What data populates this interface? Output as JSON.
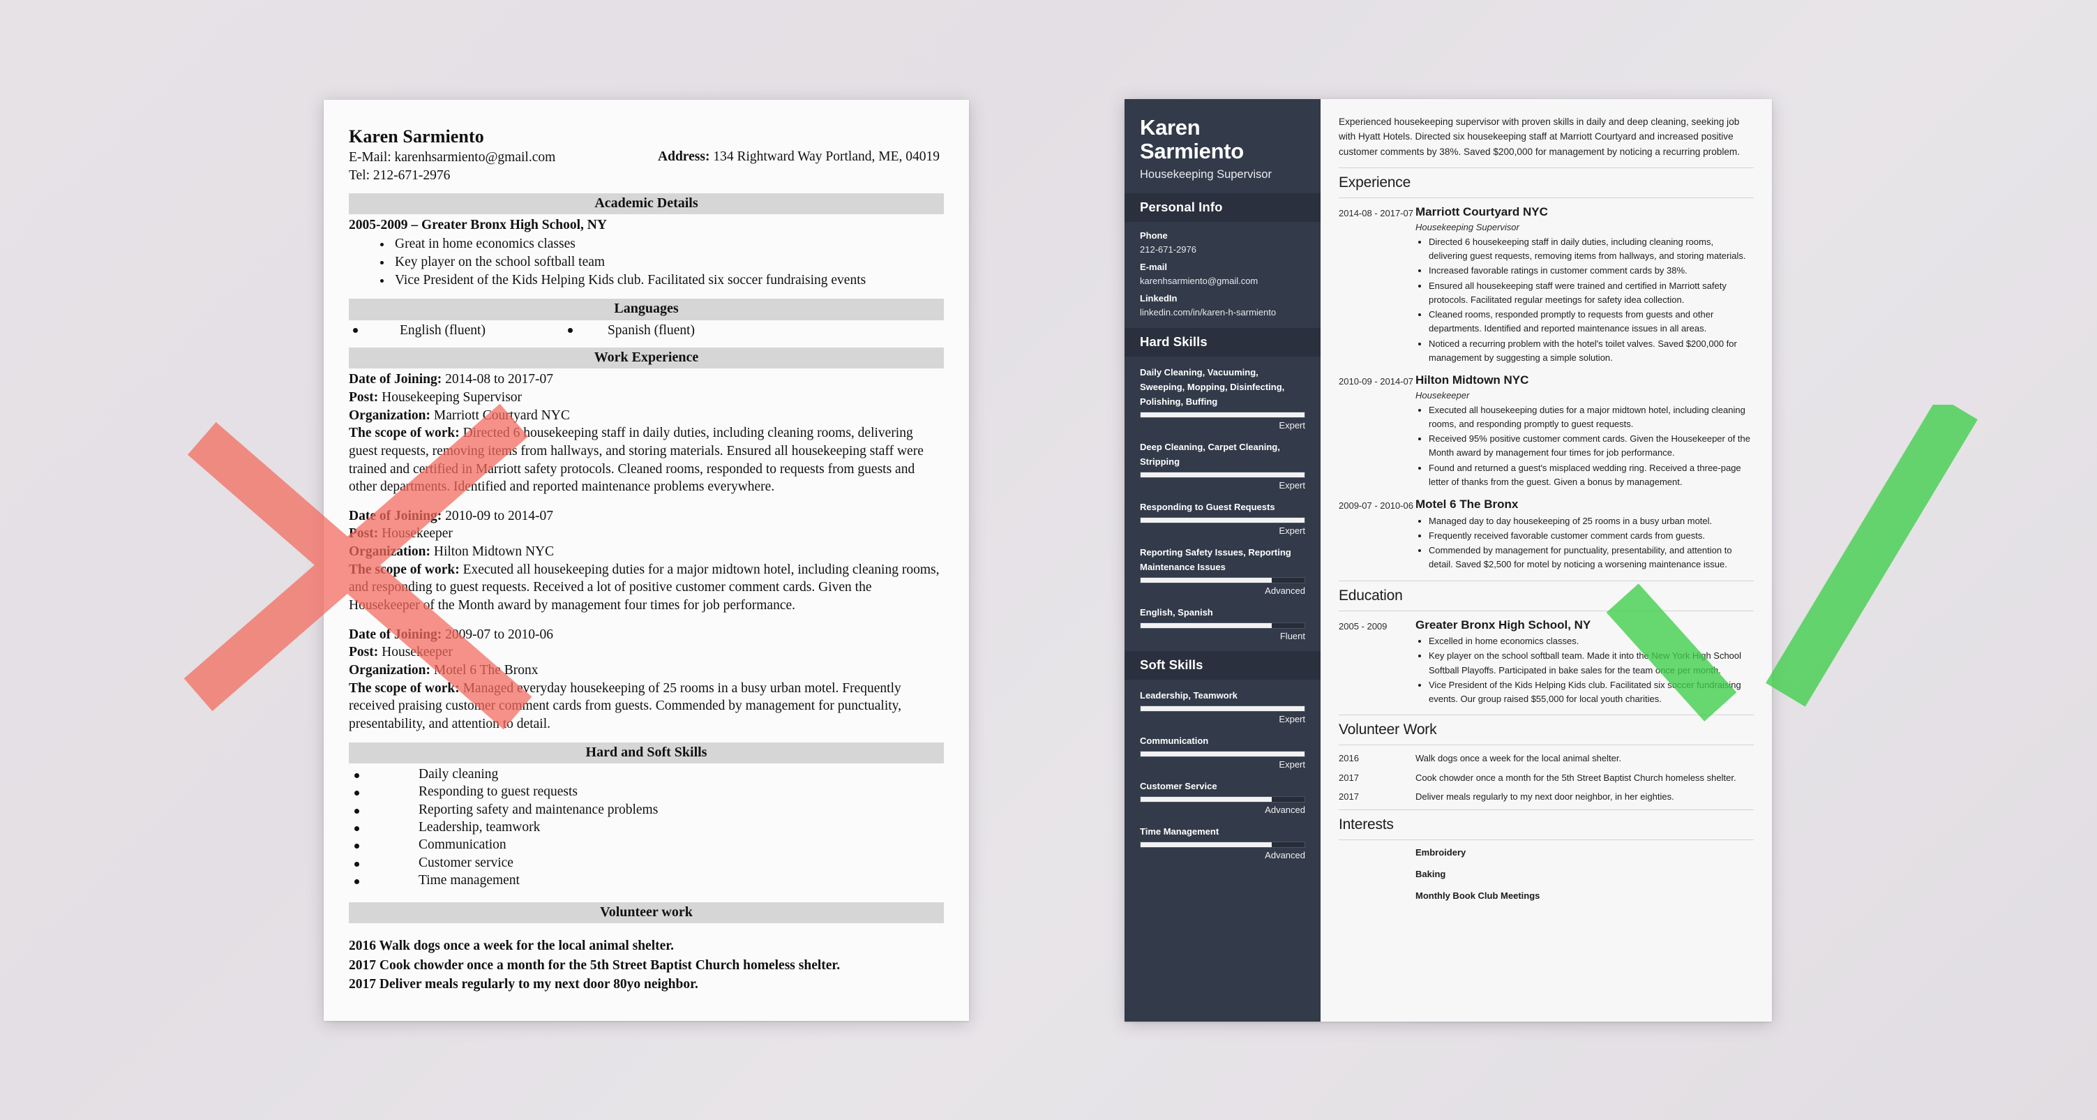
{
  "marks": {
    "bad_mark": "red-x-mark",
    "good_mark": "green-check-mark",
    "red": "#f98a80",
    "green": "#5fd467"
  },
  "bad_resume": {
    "name": "Karen Sarmiento",
    "email_line": "E-Mail: karenhsarmiento@gmail.com",
    "tel_line": "Tel: 212-671-2976",
    "address_label": "Address:",
    "address_value": "134 Rightward Way Portland, ME, 04019",
    "academic": {
      "heading": "Academic Details",
      "school_line": "2005-2009 – Greater Bronx High School, NY",
      "bullets": [
        "Great in home economics classes",
        "Key player on the school softball team",
        "Vice President of the Kids Helping Kids club. Facilitated six soccer fundraising events"
      ]
    },
    "languages": {
      "heading": "Languages",
      "items": [
        "English (fluent)",
        "Spanish (fluent)"
      ]
    },
    "work": {
      "heading": "Work Experience",
      "jobs": [
        {
          "date_label": "Date of Joining:",
          "date_value": "2014-08 to 2017-07",
          "post_label": "Post:",
          "post_value": "Housekeeping Supervisor",
          "org_label": "Organization:",
          "org_value": "Marriott Courtyard NYC",
          "scope_label": "The scope of work:",
          "scope_value": "Directed 6 housekeeping staff in daily duties, including cleaning rooms, delivering guest requests, removing items from hallways, and storing materials. Ensured all housekeeping staff were trained and certified in Marriott safety protocols. Cleaned rooms, responded to requests from guests and other departments. Identified and reported maintenance problems everywhere."
        },
        {
          "date_label": "Date of Joining:",
          "date_value": "2010-09 to 2014-07",
          "post_label": "Post:",
          "post_value": "Housekeeper",
          "org_label": "Organization:",
          "org_value": "Hilton Midtown NYC",
          "scope_label": "The scope of work:",
          "scope_value": "Executed all housekeeping duties for a major midtown hotel, including cleaning rooms, and responding to guest requests. Received a lot of positive customer comment cards. Given the Housekeeper of the Month award by management four times for job performance."
        },
        {
          "date_label": "Date of Joining:",
          "date_value": "2009-07 to 2010-06",
          "post_label": "Post:",
          "post_value": "Housekeeper",
          "org_label": "Organization:",
          "org_value": "Motel 6 The Bronx",
          "scope_label": "The scope of work:",
          "scope_value": "Managed everyday housekeeping of 25 rooms in a busy urban motel. Frequently received praising customer comment cards from guests. Commended by management for punctuality, presentability, and attention to detail."
        }
      ]
    },
    "skills": {
      "heading": "Hard and Soft Skills",
      "items": [
        "Daily cleaning",
        "Responding to guest requests",
        "Reporting safety and maintenance problems",
        "Leadership, teamwork",
        "Communication",
        "Customer service",
        "Time management"
      ]
    },
    "volunteer": {
      "heading": "Volunteer work",
      "items": [
        {
          "year": "2016",
          "text": "Walk dogs once a week for the local animal shelter."
        },
        {
          "year": "2017",
          "text": "Cook chowder once a month for the 5th Street Baptist Church homeless shelter."
        },
        {
          "year": "2017",
          "text": "Deliver meals regularly to my next door 80yo neighbor."
        }
      ]
    }
  },
  "good_resume": {
    "sidebar": {
      "name": "Karen Sarmiento",
      "job_title": "Housekeeping Supervisor",
      "personal_info": {
        "heading": "Personal Info",
        "fields": [
          {
            "label": "Phone",
            "value": "212-671-2976"
          },
          {
            "label": "E-mail",
            "value": "karenhsarmiento@gmail.com"
          },
          {
            "label": "LinkedIn",
            "value": "linkedin.com/in/karen-h-sarmiento"
          }
        ]
      },
      "hard_skills": {
        "heading": "Hard Skills",
        "items": [
          {
            "name": "Daily Cleaning, Vacuuming, Sweeping, Mopping, Disinfecting, Polishing, Buffing",
            "level": "Expert",
            "percent": 100
          },
          {
            "name": "Deep Cleaning, Carpet Cleaning, Stripping",
            "level": "Expert",
            "percent": 100
          },
          {
            "name": "Responding to Guest Requests",
            "level": "Expert",
            "percent": 100
          },
          {
            "name": "Reporting Safety Issues, Reporting Maintenance Issues",
            "level": "Advanced",
            "percent": 80
          },
          {
            "name": "English, Spanish",
            "level": "Fluent",
            "percent": 80
          }
        ]
      },
      "soft_skills": {
        "heading": "Soft Skills",
        "items": [
          {
            "name": "Leadership, Teamwork",
            "level": "Expert",
            "percent": 100
          },
          {
            "name": "Communication",
            "level": "Expert",
            "percent": 100
          },
          {
            "name": "Customer Service",
            "level": "Advanced",
            "percent": 80
          },
          {
            "name": "Time Management",
            "level": "Advanced",
            "percent": 80
          }
        ]
      }
    },
    "main": {
      "summary": "Experienced housekeeping supervisor with proven skills in daily and deep cleaning, seeking job with Hyatt Hotels. Directed six housekeeping staff at Marriott Courtyard and increased positive customer comments by 38%. Saved $200,000 for management by noticing a recurring problem.",
      "experience": {
        "heading": "Experience",
        "entries": [
          {
            "dates": "2014-08 - 2017-07",
            "org": "Marriott Courtyard NYC",
            "role": "Housekeeping Supervisor",
            "bullets": [
              "Directed 6 housekeeping staff in daily duties, including cleaning rooms, delivering guest requests, removing items from hallways, and storing materials.",
              "Increased favorable ratings in customer comment cards by 38%.",
              "Ensured all housekeeping staff were trained and certified in Marriott safety protocols. Facilitated regular meetings for safety idea collection.",
              "Cleaned rooms, responded promptly to requests from guests and other departments. Identified and reported maintenance issues in all areas.",
              "Noticed a recurring problem with the hotel's toilet valves. Saved $200,000 for management by suggesting a simple solution."
            ]
          },
          {
            "dates": "2010-09 - 2014-07",
            "org": "Hilton Midtown NYC",
            "role": "Housekeeper",
            "bullets": [
              "Executed all housekeeping duties for a major midtown hotel, including cleaning rooms, and responding promptly to guest requests.",
              "Received 95% positive customer comment cards. Given the Housekeeper of the Month award by management four times for job performance.",
              "Found and returned a guest's misplaced wedding ring. Received a three-page letter of thanks from the guest. Given a bonus by management."
            ]
          },
          {
            "dates": "2009-07 - 2010-06",
            "org": "Motel 6 The Bronx",
            "role": "",
            "bullets": [
              "Managed day to day housekeeping of 25 rooms in a busy urban motel.",
              "Frequently received favorable customer comment cards from guests.",
              "Commended by management for punctuality, presentability, and attention to detail. Saved $2,500 for motel by noticing a worsening maintenance issue."
            ]
          }
        ]
      },
      "education": {
        "heading": "Education",
        "entries": [
          {
            "dates": "2005 - 2009",
            "org": "Greater Bronx High School, NY",
            "role": "",
            "bullets": [
              "Excelled in home economics classes.",
              "Key player on the school softball team. Made it into the New York High School Softball Playoffs. Participated in bake sales for the team once per month.",
              "Vice President of the Kids Helping Kids club. Facilitated six soccer fundraising events. Our group raised $55,000 for local youth charities."
            ]
          }
        ]
      },
      "volunteer": {
        "heading": "Volunteer Work",
        "rows": [
          {
            "year": "2016",
            "text": "Walk dogs once a week for the local animal shelter."
          },
          {
            "year": "2017",
            "text": "Cook chowder once a month for the 5th Street Baptist Church homeless shelter."
          },
          {
            "year": "2017",
            "text": "Deliver meals regularly to my next door neighbor, in her eighties."
          }
        ]
      },
      "interests": {
        "heading": "Interests",
        "items": [
          "Embroidery",
          "Baking",
          "Monthly Book Club Meetings"
        ]
      }
    }
  }
}
